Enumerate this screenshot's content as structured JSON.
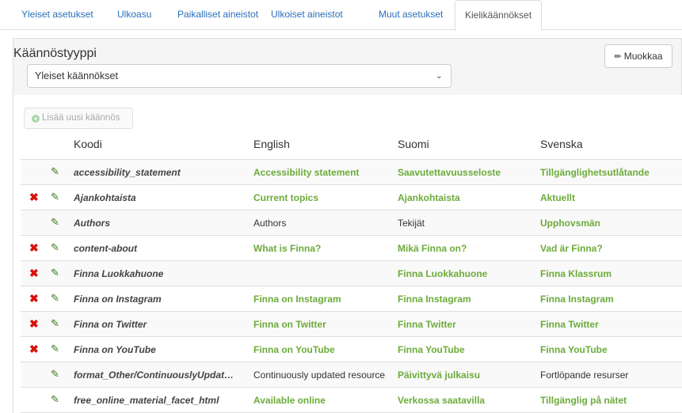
{
  "tabs": [
    {
      "label": "Yleiset asetukset"
    },
    {
      "label": "Ulkoasu"
    },
    {
      "label": "Paikalliset aineistot"
    },
    {
      "label": "Ulkoiset aineistot"
    },
    {
      "label": "Muut asetukset"
    },
    {
      "label": "Kielikäännökset",
      "active": true
    }
  ],
  "panel": {
    "title": "Käännöstyyppi",
    "select_value": "Yleiset käännökset",
    "edit_label": "Muokkaa",
    "add_label": "Lisää uusi käännös"
  },
  "colors": {
    "link": "#2a6ebb",
    "translated": "#6cab3a",
    "delete": "#d9110c",
    "pencil": "#3a7d1a"
  },
  "table": {
    "headers": {
      "code": "Koodi",
      "en": "English",
      "fi": "Suomi",
      "sv": "Svenska"
    },
    "rows": [
      {
        "deletable": false,
        "code": "accessibility_statement",
        "en": "Accessibility statement",
        "en_style": "g",
        "fi": "Saavutettavuusseloste",
        "fi_style": "g",
        "sv": "Tillgänglighetsutlåtande",
        "sv_style": "g"
      },
      {
        "deletable": true,
        "code": "Ajankohtaista",
        "en": "Current topics",
        "en_style": "g",
        "fi": "Ajankohtaista",
        "fi_style": "g",
        "sv": "Aktuellt",
        "sv_style": "g"
      },
      {
        "deletable": false,
        "code": "Authors",
        "en": "Authors",
        "en_style": "p",
        "fi": "Tekijät",
        "fi_style": "p",
        "sv": "Upphovsmän",
        "sv_style": "g"
      },
      {
        "deletable": true,
        "code": "content-about",
        "en": "What is Finna?",
        "en_style": "g",
        "fi": "Mikä Finna on?",
        "fi_style": "g",
        "sv": "Vad är Finna?",
        "sv_style": "g"
      },
      {
        "deletable": true,
        "code": "Finna Luokkahuone",
        "en": "",
        "en_style": "g",
        "fi": "Finna Luokkahuone",
        "fi_style": "g",
        "sv": "Finna Klassrum",
        "sv_style": "g"
      },
      {
        "deletable": true,
        "code": "Finna on Instagram",
        "en": "Finna on Instagram",
        "en_style": "g",
        "fi": "Finna Instagram",
        "fi_style": "g",
        "sv": "Finna Instagram",
        "sv_style": "g"
      },
      {
        "deletable": true,
        "code": "Finna on Twitter",
        "en": "Finna on Twitter",
        "en_style": "g",
        "fi": "Finna Twitter",
        "fi_style": "g",
        "sv": "Finna Twitter",
        "sv_style": "g"
      },
      {
        "deletable": true,
        "code": "Finna on YouTube",
        "en": "Finna on YouTube",
        "en_style": "g",
        "fi": "Finna YouTube",
        "fi_style": "g",
        "sv": "Finna YouTube",
        "sv_style": "g"
      },
      {
        "deletable": false,
        "code": "format_Other/ContinuouslyUpdate...",
        "en": "Continuously updated resource",
        "en_style": "p",
        "fi": "Päivittyvä julkaisu",
        "fi_style": "g",
        "sv": "Fortlöpande resurser",
        "sv_style": "p"
      },
      {
        "deletable": false,
        "code": "free_online_material_facet_html",
        "en": "Available online",
        "en_style": "g",
        "fi": "Verkossa saatavilla",
        "fi_style": "g",
        "sv": "Tillgänglig på nätet",
        "sv_style": "g"
      }
    ]
  }
}
